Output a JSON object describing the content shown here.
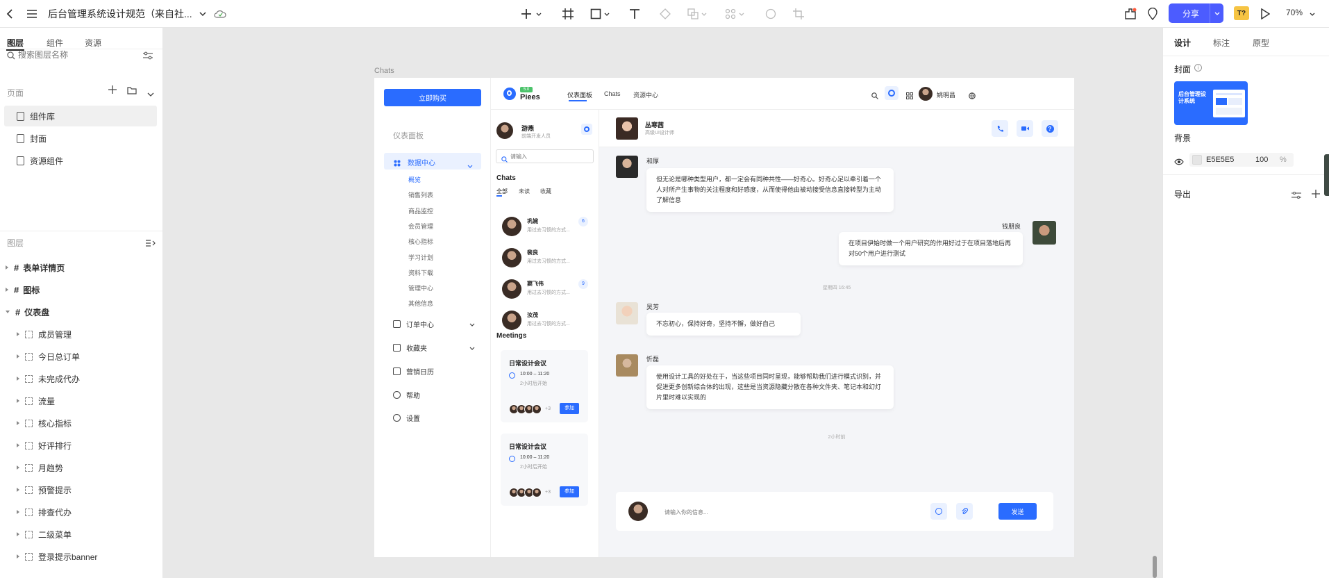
{
  "topbar": {
    "doc_title": "后台管理系统设计规范（来自社...",
    "share": "分享",
    "zoom": "70%",
    "badge": "T?"
  },
  "left": {
    "tabs": [
      "图层",
      "组件",
      "资源"
    ],
    "search_placeholder": "搜索图层名称",
    "pages_title": "页面",
    "pages": [
      "组件库",
      "封面",
      "资源组件"
    ],
    "layers_title": "图层",
    "layers": [
      {
        "label": "表单详情页",
        "kind": "frame",
        "expanded": false,
        "indent": 0
      },
      {
        "label": "图标",
        "kind": "frame",
        "expanded": false,
        "indent": 0
      },
      {
        "label": "仪表盘",
        "kind": "frame",
        "expanded": true,
        "indent": 0
      },
      {
        "label": "成员管理",
        "kind": "comp",
        "indent": 1
      },
      {
        "label": "今日总订单",
        "kind": "comp",
        "indent": 1
      },
      {
        "label": "未完成代办",
        "kind": "comp",
        "indent": 1
      },
      {
        "label": "流量",
        "kind": "comp",
        "indent": 1
      },
      {
        "label": "核心指标",
        "kind": "comp",
        "indent": 1
      },
      {
        "label": "好评排行",
        "kind": "comp",
        "indent": 1
      },
      {
        "label": "月趋势",
        "kind": "comp",
        "indent": 1
      },
      {
        "label": "预警提示",
        "kind": "comp",
        "indent": 1
      },
      {
        "label": "排查代办",
        "kind": "comp",
        "indent": 1
      },
      {
        "label": "二级菜单",
        "kind": "comp",
        "indent": 1
      },
      {
        "label": "登录提示banner",
        "kind": "comp",
        "indent": 1
      }
    ]
  },
  "right": {
    "tabs": [
      "设计",
      "标注",
      "原型"
    ],
    "cover_title": "封面",
    "cover_text": "后台管理设计系统",
    "bg_title": "背景",
    "bg_hex": "E5E5E5",
    "bg_opacity": "100",
    "bg_pct": "%",
    "export_title": "导出"
  },
  "frame": {
    "label": "Chats",
    "sidebar": {
      "buy_btn": "立即购买",
      "section": "仪表面板",
      "group_open": "数据中心",
      "sub": [
        "概览",
        "销售列表",
        "商品监控",
        "会员管理",
        "核心指标",
        "学习计划",
        "资料下载",
        "管理中心",
        "其他信息"
      ],
      "items": [
        "订单中心",
        "收藏夹",
        "营销日历",
        "帮助",
        "设置"
      ]
    },
    "nav": {
      "logo": "Piees",
      "logo_tag": "5.0",
      "links": [
        "仪表面板",
        "Chats",
        "资源中心"
      ],
      "user": "姚明昌"
    },
    "chatlist": {
      "me_name": "游燕",
      "me_role": "前端开发人员",
      "search_placeholder": "请输入",
      "heading": "Chats",
      "filters": [
        "全部",
        "未读",
        "收藏"
      ],
      "items": [
        {
          "name": "巩婉",
          "preview": "用过去习惯的方式...",
          "badge": "6"
        },
        {
          "name": "裴良",
          "preview": "用过去习惯的方式...",
          "badge": ""
        },
        {
          "name": "窦飞伟",
          "preview": "用过去习惯的方式...",
          "badge": "9"
        },
        {
          "name": "汝茂",
          "preview": "用过去习惯的方式...",
          "badge": ""
        }
      ],
      "meetings_heading": "Meetings",
      "meetings": [
        {
          "title": "日常设计会议",
          "time": "10:00 – 11:20",
          "note": "2小时后开始",
          "more": "+3",
          "join": "参加"
        },
        {
          "title": "日常设计会议",
          "time": "10:00 – 11:20",
          "note": "2小时后开始",
          "more": "+3",
          "join": "参加"
        }
      ]
    },
    "chat": {
      "contact_name": "丛寒茜",
      "contact_role": "高级UI设计师",
      "messages": [
        {
          "name": "和厚",
          "text": "但无论是哪种类型用户，都一定会有同种共性——好奇心。好奇心足以牵引着一个人对所产生事物的关注程度和好感度，从而使得他由被动接受信息直接转型为主动了解信息",
          "side": "left"
        },
        {
          "name": "钱朋良",
          "text": "在项目伊始时做一个用户研究的作用好过于在项目落地后再对50个用户进行测试",
          "side": "right"
        },
        {
          "name": "吴芳",
          "text": "不忘初心，保持好奇，坚持不懈，做好自己",
          "side": "left"
        },
        {
          "name": "忻磊",
          "text": "使用设计工具的好处在于，当这些项目同时呈现，能够帮助我们进行模式识别，并促进更多创新综合体的出现，这些是当资源隐藏分散在各种文件夹、笔记本和幻灯片里时难以实现的",
          "side": "left"
        }
      ],
      "time_divider": "星期四 16:45",
      "time_divider2": "2小时前",
      "input_placeholder": "请输入你的信息...",
      "send": "发送"
    }
  },
  "colors": {
    "accent": "#2a6cff",
    "canvas": "#e8e8e8"
  }
}
